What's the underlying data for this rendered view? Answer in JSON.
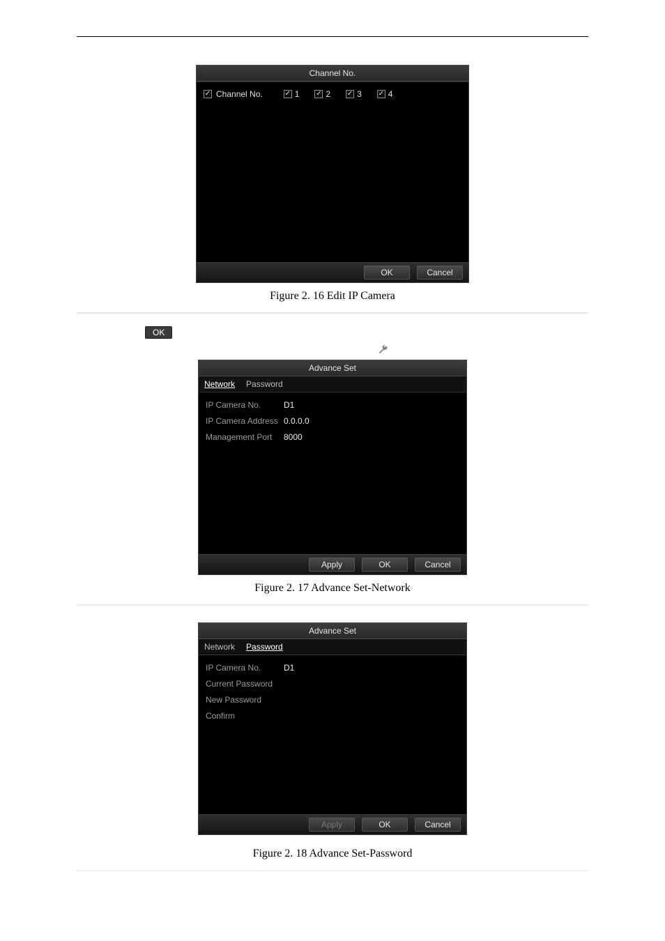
{
  "dlg1": {
    "title": "Channel No.",
    "row_label": "Channel No.",
    "items": [
      "1",
      "2",
      "3",
      "4"
    ],
    "ok": "OK",
    "cancel": "Cancel"
  },
  "caption1": "Figure 2. 16 Edit IP Camera",
  "ok_inline": "OK",
  "dlg2": {
    "title": "Advance Set",
    "tab_network": "Network",
    "tab_password": "Password",
    "rows": {
      "no_l": "IP Camera No.",
      "no_v": "D1",
      "addr_l": "IP Camera Address",
      "addr_v": "0.0.0.0",
      "port_l": "Management Port",
      "port_v": "8000"
    },
    "apply": "Apply",
    "ok": "OK",
    "cancel": "Cancel"
  },
  "caption2": "Figure 2. 17 Advance Set-Network",
  "dlg3": {
    "title": "Advance Set",
    "tab_network": "Network",
    "tab_password": "Password",
    "rows": {
      "no_l": "IP Camera No.",
      "no_v": "D1",
      "cur_l": "Current Password",
      "cur_v": "",
      "new_l": "New Password",
      "new_v": "",
      "conf_l": "Confirm",
      "conf_v": ""
    },
    "apply": "Apply",
    "ok": "OK",
    "cancel": "Cancel"
  },
  "caption3": "Figure 2. 18 Advance Set-Password"
}
